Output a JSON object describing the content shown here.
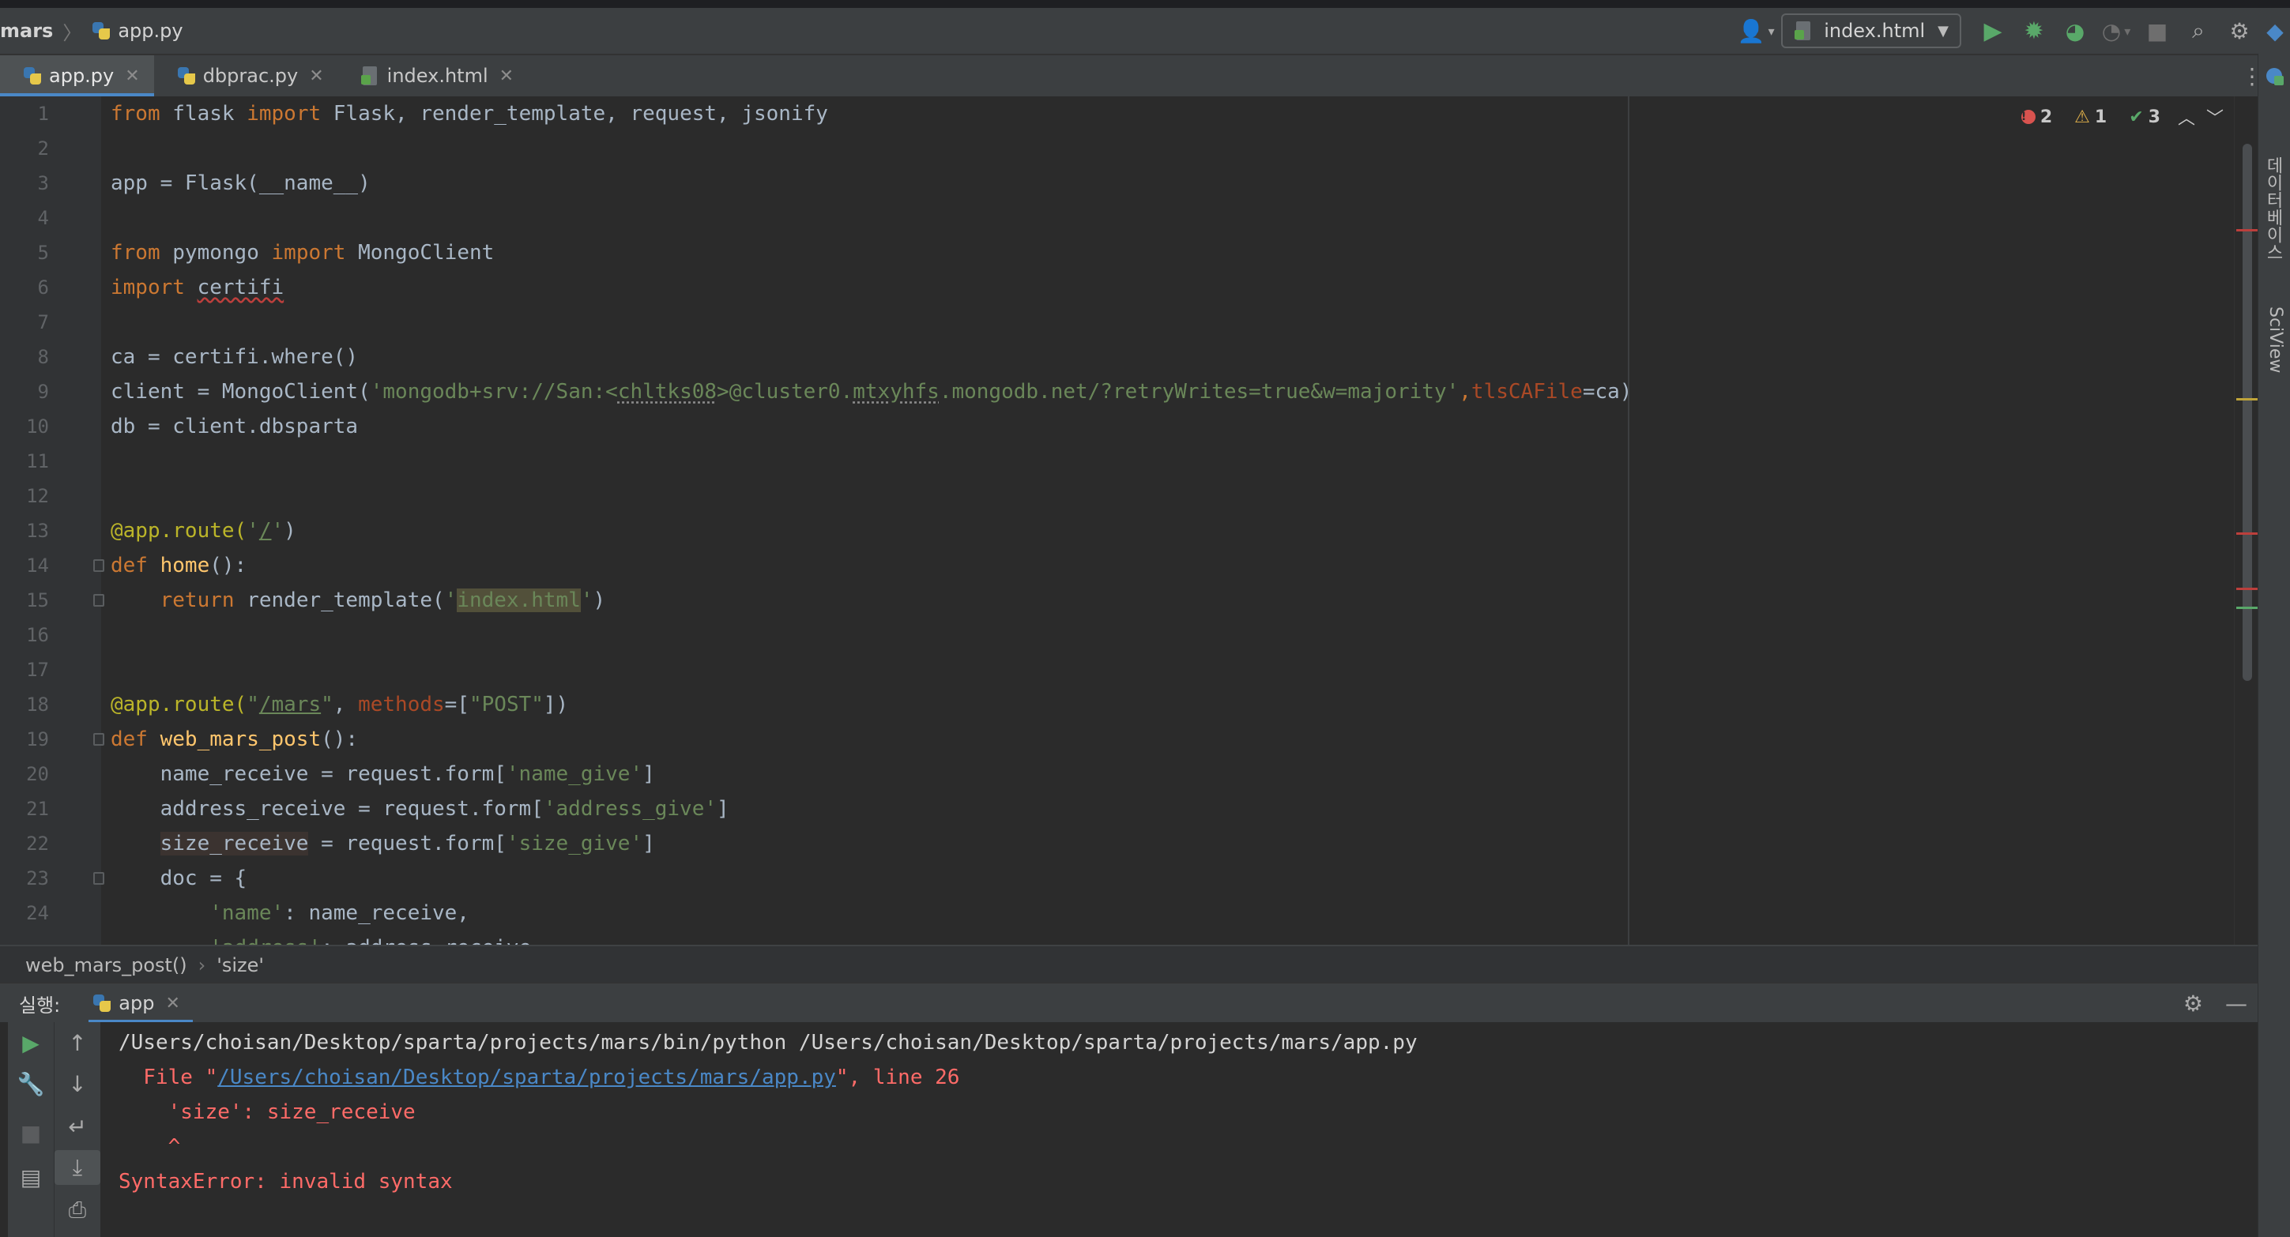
{
  "navbar": {
    "project": "mars",
    "file": "app.py",
    "run_config": "index.html"
  },
  "tabs": [
    {
      "label": "app.py"
    },
    {
      "label": "dbprac.py"
    },
    {
      "label": "index.html"
    }
  ],
  "inspections": {
    "errors": "2",
    "warnings": "1",
    "ok": "3"
  },
  "editor": {
    "line_numbers": [
      "1",
      "2",
      "3",
      "4",
      "5",
      "6",
      "7",
      "8",
      "9",
      "10",
      "11",
      "12",
      "13",
      "14",
      "15",
      "16",
      "17",
      "18",
      "19",
      "20",
      "21",
      "22",
      "23",
      "24"
    ],
    "code": {
      "l1_from": "from",
      "l1_flask": " flask ",
      "l1_import": "import",
      "l1_rest": " Flask, render_template, request, jsonify",
      "l3": "app = Flask(__name__)",
      "l5_from": "from",
      "l5_mid": " pymongo ",
      "l5_import": "import",
      "l5_rest": " MongoClient",
      "l6_import": "import",
      "l6_mod": "certifi",
      "l8": "ca = certifi.where()",
      "l9_pre": "client = MongoClient(",
      "l9_s1": "'mongodb+srv://San:<",
      "l9_s2": "chltks08",
      "l9_s3": ">@cluster0.",
      "l9_s4": "mtxyhfs",
      "l9_s5": ".mongodb.net/?retryWrites=true&w=majority'",
      "l9_comma": ",",
      "l9_param": "tlsCAFile",
      "l9_post": "=ca)",
      "l10": "db = client.dbsparta",
      "l13_dec": "@app.route(",
      "l13_q1": "'",
      "l13_slash": "/",
      "l13_q2": "'",
      "l13_end": ")",
      "l14_def": "def",
      "l14_name": " home",
      "l14_end": "():",
      "l15_ret": "    return",
      "l15_mid": " render_template(",
      "l15_q1": "'",
      "l15_str": "index.html",
      "l15_q2": "'",
      "l15_end": ")",
      "l18_dec": "@app.route(",
      "l18_q1": "\"",
      "l18_path": "/mars",
      "l18_q2": "\"",
      "l18_comma": ", ",
      "l18_param": "methods",
      "l18_eq": "=[",
      "l18_post": "\"POST\"",
      "l18_end": "])",
      "l19_def": "def",
      "l19_name": " web_mars_post",
      "l19_end": "():",
      "l20_pre": "    name_receive = request.form[",
      "l20_str": "'name_give'",
      "l20_end": "]",
      "l21_pre": "    address_receive = request.form[",
      "l21_str": "'address_give'",
      "l21_end": "]",
      "l22_ind": "    ",
      "l22_var": "size_receive",
      "l22_pre": " = request.form[",
      "l22_str": "'size_give'",
      "l22_end": "]",
      "l23": "    doc = {",
      "l24_ind": "        ",
      "l24_str": "'name'",
      "l24_end": ": name_receive,",
      "l25_ind": "        ",
      "l25_str": "'address'",
      "l25_end": ": address_receive"
    }
  },
  "breadcrumb": {
    "function": "web_mars_post()",
    "item": "'size'"
  },
  "run": {
    "label": "실행:",
    "tab": "app",
    "output": {
      "line1": "/Users/choisan/Desktop/sparta/projects/mars/bin/python /Users/choisan/Desktop/sparta/projects/mars/app.py",
      "line2_pre": "  File \"",
      "line2_link": "/Users/choisan/Desktop/sparta/projects/mars/app.py",
      "line2_post": "\", line 26",
      "line3": "    'size': size_receive",
      "line4": "    ^",
      "line5": "SyntaxError: invalid syntax"
    }
  },
  "side_strip": {
    "db_label": "데이터베이스",
    "sciview_label": "SciView"
  },
  "colors": {
    "background": "#2b2b2b",
    "keyword": "#cc7832",
    "string": "#6a8759",
    "decorator": "#bbb529",
    "function": "#ffc66d",
    "error": "#ff6b68",
    "link": "#4a88c7",
    "run_green": "#59a869"
  }
}
